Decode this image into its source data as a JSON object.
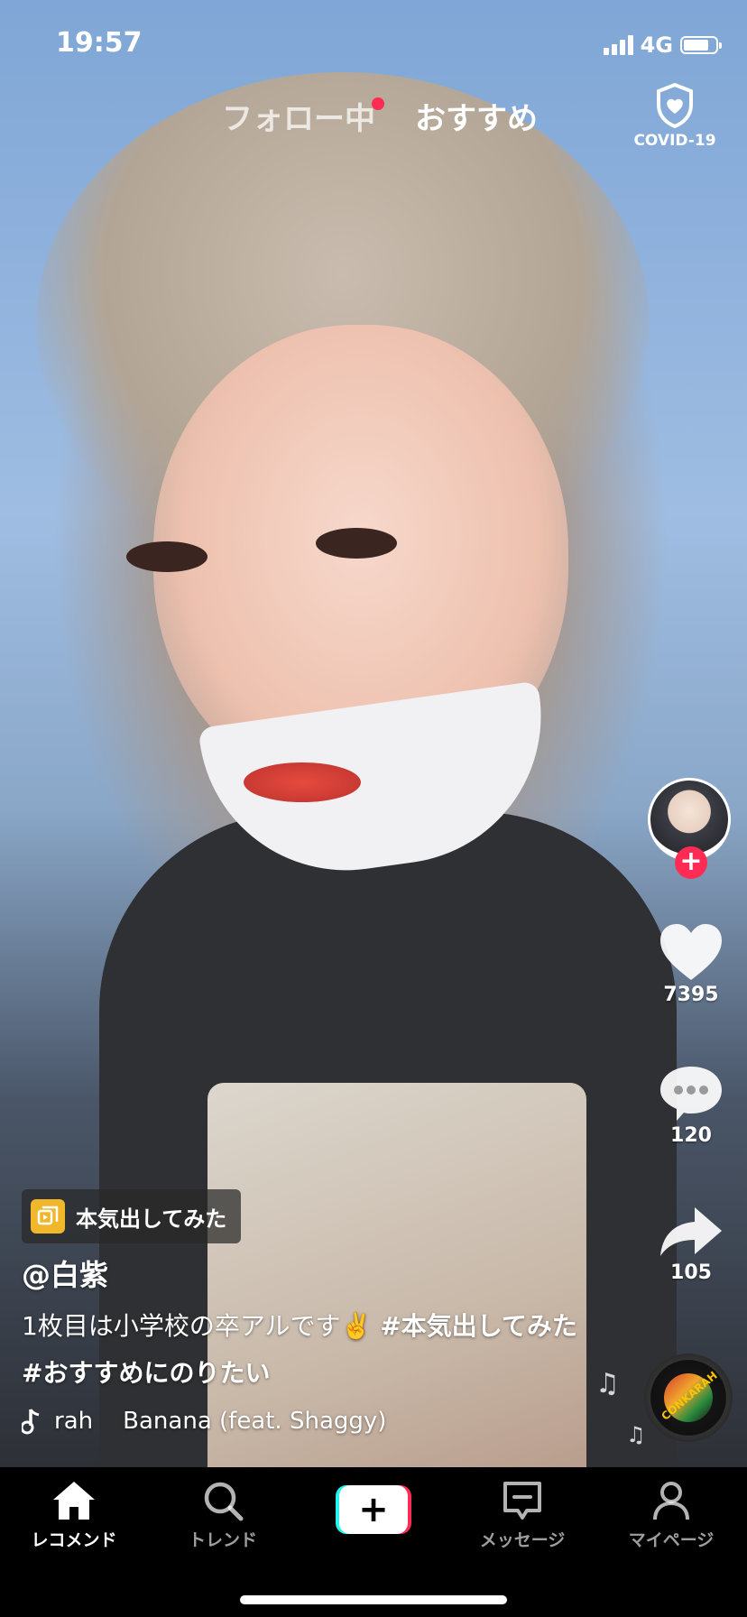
{
  "status_bar": {
    "time": "19:57",
    "network": "4G"
  },
  "top_tabs": {
    "following": "フォロー中",
    "recommended": "おすすめ"
  },
  "covid": {
    "label": "COVID-19"
  },
  "rail": {
    "likes": "7395",
    "comments": "120",
    "shares": "105",
    "follow_label": "+"
  },
  "disc": {
    "label": "CONKARAH"
  },
  "playlist": {
    "label": "本気出してみた"
  },
  "post": {
    "username": "@白紫",
    "caption_text": "1枚目は小学校の卒アルです✌️ ",
    "hashtag_1": "#本気出してみた",
    "hashtag_2": " #おすすめにのりたい",
    "music": "rah    Banana (feat. Shaggy)"
  },
  "bottom_nav": {
    "home": "レコメンド",
    "discover": "トレンド",
    "create": "+",
    "inbox": "メッセージ",
    "profile": "マイページ"
  },
  "colors": {
    "accent_red": "#fe2c55",
    "accent_cyan": "#25f4ee",
    "playlist_icon": "#f1b72a"
  },
  "icons": [
    "home-icon",
    "search-icon",
    "create-icon",
    "message-icon",
    "profile-icon",
    "heart-icon",
    "comment-icon",
    "share-icon",
    "shield-icon",
    "music-note-icon"
  ]
}
